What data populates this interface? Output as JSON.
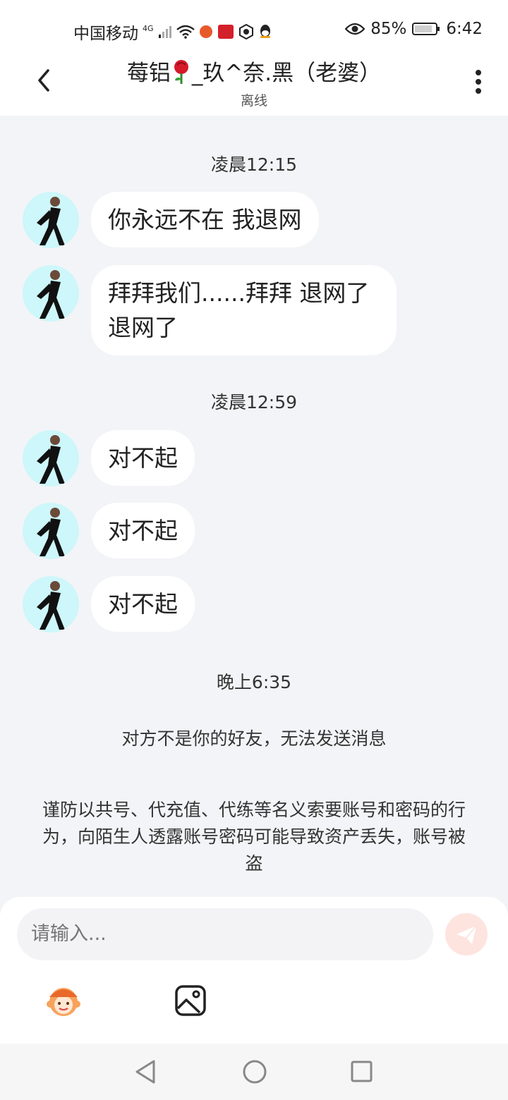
{
  "status_bar": {
    "carrier": "中国移动",
    "network": "4G",
    "battery": "85%",
    "time": "6:42"
  },
  "header": {
    "title_prefix": "莓铝",
    "title_suffix": "_玖^奈.黑（老婆）",
    "status": "离线"
  },
  "timestamps": {
    "t1": "凌晨12:15",
    "t2": "凌晨12:59",
    "t3": "晚上6:35"
  },
  "messages": [
    {
      "text": "你永远不在 我退网"
    },
    {
      "text": "拜拜我们......拜拜 退网了\n退网了"
    },
    {
      "text": "对不起"
    },
    {
      "text": "对不起"
    },
    {
      "text": "对不起"
    }
  ],
  "system": {
    "not_friend": "对方不是你的好友，无法发送消息",
    "warning": "谨防以共号、代充值、代练等名义索要账号和密码的行为，向陌生人透露账号密码可能导致资产丢失，账号被盗"
  },
  "composer": {
    "placeholder": "请输入..."
  },
  "colors": {
    "avatar_bg": "#cdf7fa",
    "send_button": "#fde4df",
    "background": "#f3f4f7"
  }
}
